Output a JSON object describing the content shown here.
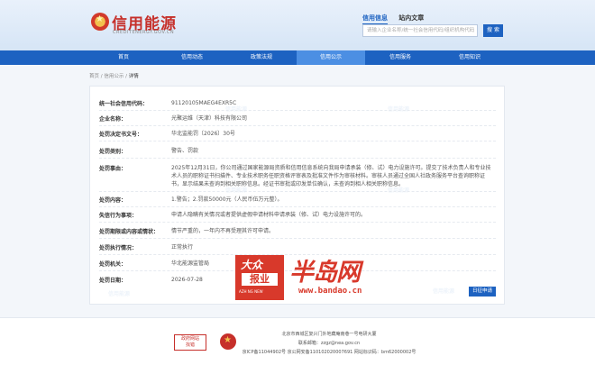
{
  "header": {
    "logo_cn": "信用能源",
    "logo_en": "CREDITENERGY.GOV.CN",
    "search_tabs": [
      "信用信息",
      "站内文章"
    ],
    "search_placeholder": "请输入企业名称/统一社会信用代码/组织机构代码",
    "search_button": "搜 索"
  },
  "nav": {
    "items": [
      "首页",
      "信用动态",
      "政策法规",
      "信用公示",
      "信用服务",
      "信用知识"
    ],
    "active_index": 3
  },
  "breadcrumb": {
    "items": [
      "首页",
      "信用公示",
      "详情"
    ],
    "separator": "/"
  },
  "detail": {
    "rows": [
      {
        "label": "统一社会信用代码：",
        "value": "91120105MAEG4EXR5C"
      },
      {
        "label": "企业名称：",
        "value": "光聚运维（天津）科技有限公司"
      },
      {
        "label": "处罚决定书文号：",
        "value": "华北监能罚〔2026〕30号"
      },
      {
        "label": "处罚类别：",
        "value": "警告、罚款"
      },
      {
        "label": "处罚事由：",
        "value": "2025年12月31日，你公司通过国家能源局资质和信用信息系统向我局申请承装（修、试）电力设施许可。提交了技术负责人和专业技术人员的职称证书扫描件、专业技术职务任职资格评审表及批准文件作为审核材料。审核人员通过全国人社政务服务平台查询职称证书，显示结果未查询到相关职称信息。经证书审批或印发单位确认，未查询到相人相关职称信息。"
      },
      {
        "label": "处罚内容：",
        "value": "1.警告；2.罚款50000元（人民币伍万元整）。"
      },
      {
        "label": "失信行为事项：",
        "value": "申请人隐瞒有关情况或者提供虚假申请材料申请承装（修、试）电力设施许可的。"
      },
      {
        "label": "处罚期限或内容或情状：",
        "value": "情节严重的，一年内不再受理其许可申请。"
      },
      {
        "label": "处罚执行情况：",
        "value": "正常执行"
      },
      {
        "label": "处罚机关：",
        "value": "华北能源监管局"
      },
      {
        "label": "处罚日期：",
        "value": "2026-07-28"
      }
    ],
    "watermark": "信用能源",
    "provider_button": "日征申请"
  },
  "ads": {
    "daily_top": "大众",
    "daily_mid": "报业",
    "daily_bottom": "AZH NG NEW",
    "bandao_title": "半岛网",
    "bandao_url": "www.bandao.cn"
  },
  "footer": {
    "gov_badge_line1": "政府网站",
    "gov_badge_line2": "找错",
    "address": "北京市西城区复兴门外地藏庵南巷一号电研大厦",
    "email": "联系邮箱：zzgz@nea.gov.cn",
    "icp": "京ICP备11044902号 京公网安备110102020007691 网站标识码：bm62000002号"
  },
  "colors": {
    "brand_blue": "#1d62c1",
    "brand_red": "#c62f2a",
    "nav_active": "#4c8fe3"
  }
}
